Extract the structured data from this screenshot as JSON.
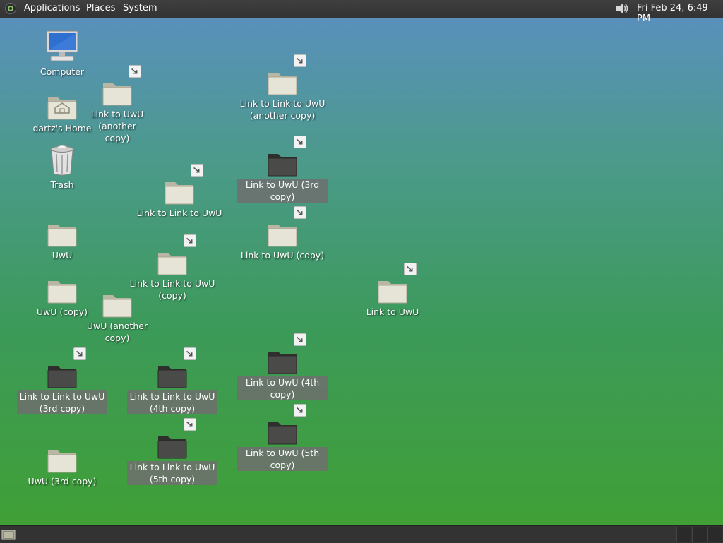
{
  "top_panel": {
    "menus": [
      "Applications",
      "Places",
      "System"
    ],
    "clock": "Fri Feb 24,  6:49 PM"
  },
  "icons": {
    "computer": "Computer",
    "home": "dartz's Home",
    "trash": "Trash",
    "uwu": "UwU",
    "uwu_copy": "UwU (copy)",
    "uwu_another": "UwU (another copy)",
    "uwu_3rd": "UwU (3rd copy)",
    "link_uwu_another": "Link to UwU (another\ncopy)",
    "link_link_uwu": "Link to Link to UwU",
    "link_link_uwu_copy": "Link to Link to UwU\n(copy)",
    "link_link_uwu_another": "Link to Link to UwU\n(another copy)",
    "link_uwu_3rd": "Link to UwU (3rd copy)",
    "link_uwu_copy": "Link to UwU (copy)",
    "link_uwu": "Link to UwU",
    "link_uwu_4th": "Link to UwU (4th copy)",
    "link_uwu_5th": "Link to UwU (5th copy)",
    "link_link_uwu_3rd": "Link to Link to UwU\n(3rd copy)",
    "link_link_uwu_4th": "Link to Link to UwU\n(4th copy)",
    "link_link_uwu_5th": "Link to Link to UwU\n(5th copy)"
  }
}
